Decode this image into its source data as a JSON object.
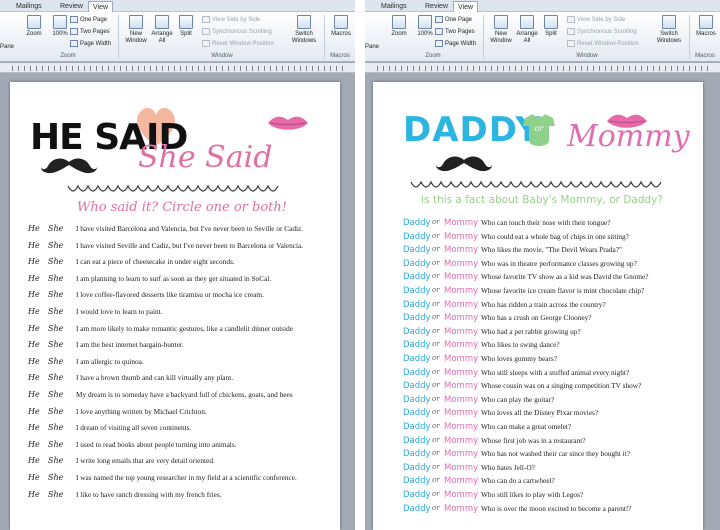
{
  "left_window": {
    "tabs": [
      "Mailings",
      "Review",
      "View"
    ],
    "ribbon": {
      "pane_label": "Pane",
      "zoom_btn": "Zoom",
      "hundred_btn": "100%",
      "one_page": "One Page",
      "two_pages": "Two Pages",
      "page_width": "Page Width",
      "new_window": "New Window",
      "arrange_all": "Arrange All",
      "split": "Split",
      "view_side_by_side": "View Side by Side",
      "sync_scrolling": "Synchronous Scrolling",
      "reset_window_position": "Reset Window Position",
      "switch_windows": "Switch Windows",
      "macros": "Macros",
      "group_zoom": "Zoom",
      "group_window": "Window",
      "group_macros": "Macros"
    },
    "document": {
      "heading_he_said": "HE SAID",
      "heading_she_said": "She Said",
      "tagline": "Who said it? Circle one or both!",
      "he_label": "He",
      "she_label": "She",
      "questions": [
        "I have visited Barcelona and Valencia, but I've never been to Seville or Cadiz.",
        "I have visited Seville and Cadiz, but I've never been to Barcelona or Valencia.",
        "I can eat a piece of cheesecake in under eight seconds.",
        "I am planning to learn to surf as soon as they get situated in SoCal.",
        "I love coffee-flavored desserts like tiramisu or mocha ice cream.",
        "I would love to learn to paint.",
        "I am more likely to make romantic gestures, like a candlelit dinner outside",
        "I am the best internet bargain-hunter.",
        "I am allergic to quinoa.",
        "I have a brown thumb and can kill virtually any plant.",
        "My dream is to someday have a backyard full of chickens, goats, and bees",
        "I love anything written by Michael Crichton.",
        "I dream of visiting all seven continents.",
        "I used to read books about people turning into animals.",
        "I write long emails that are very detail oriented.",
        "I was named the top young researcher in my field at a scientific conference.",
        "I like to have ranch dressing with my french fries."
      ]
    }
  },
  "right_window": {
    "tabs": [
      "Mailings",
      "Review",
      "View"
    ],
    "ribbon": {
      "pane_label": "Pane",
      "zoom_btn": "Zoom",
      "hundred_btn": "100%",
      "one_page": "One Page",
      "two_pages": "Two Pages",
      "page_width": "Page Width",
      "new_window": "New Window",
      "arrange_all": "Arrange All",
      "split": "Split",
      "view_side_by_side": "View Side by Side",
      "sync_scrolling": "Synchronous Scrolling",
      "reset_window_position": "Reset Window Position",
      "switch_windows": "Switch Windows",
      "macros": "Macros",
      "group_zoom": "Zoom",
      "group_window": "Window",
      "group_macros": "Macros"
    },
    "document": {
      "heading_daddy": "DADDY",
      "heading_or": "or",
      "heading_mommy": "Mommy",
      "tagline": "Is this a fact about Baby's Mommy, or Daddy?",
      "daddy_label": "Daddy",
      "or_label": "or",
      "mommy_label": "Mommy",
      "questions": [
        "Who can touch their nose with their tongue?",
        "Who could eat a whole bag of chips in one sitting?",
        "Who likes the movie, \"The Devil Wears Prada?\"",
        "Who was in theatre performance classes growing up?",
        "Whose favorite TV show as a kid was David the Gnome?",
        "Whose favorite ice cream flavor is mint chocolate chip?",
        "Who has ridden a train across the country?",
        "Who has a crush on George Clooney?",
        "Who had a pet rabbit growing up?",
        "Who likes to swing dance?",
        "Who loves gummy bears?",
        "Who still sleeps with a stuffed animal every night?",
        "Whose cousin was on a singing competition TV show?",
        "Who can play the guitar?",
        "Who loves all the Disney Pixar movies?",
        "Who can make a great omelet?",
        "Whose first job was in a restaurant?",
        "Who has not washed their car since they bought it?",
        "Who hates Jell-O?",
        "Who can do a cartwheel?",
        "Who still likes to play with Legos?",
        "Who is over the moon excited to become a parent!?"
      ]
    }
  },
  "colors": {
    "accent_pink": "#e06fa4",
    "daddy_blue": "#2cb5e0",
    "mommy_pink": "#e36db2",
    "tagline_green": "#9bcf8c",
    "heart_peach": "#f6b7a0",
    "lips_pink": "#e76aa8",
    "onesie_green": "#8fd08a"
  },
  "icons": {
    "zoom": "zoom-icon",
    "hundred": "actual-size-icon",
    "one_page": "one-page-icon",
    "two_pages": "two-pages-icon",
    "page_width": "page-width-icon",
    "new_window": "new-window-icon",
    "arrange_all": "arrange-all-icon",
    "split": "split-icon",
    "switch_windows": "switch-windows-icon",
    "macros": "macros-icon",
    "mustache": "mustache-icon",
    "lips": "lips-icon",
    "heart": "heart-icon",
    "onesie": "onesie-icon"
  }
}
